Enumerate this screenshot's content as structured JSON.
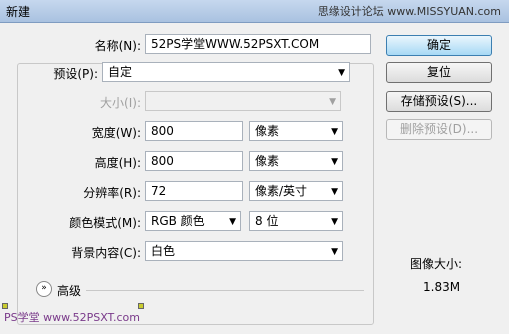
{
  "window": {
    "title": "新建",
    "watermark_top": "思缘设计论坛 www.MISSYUAN.com",
    "watermark_bottom": "PS学堂 www.52PSXT.com"
  },
  "form": {
    "name_label": "名称(N):",
    "name_value": "52PS学堂WWW.52PSXT.COM",
    "preset_label": "预设(P):",
    "preset_value": "自定",
    "size_label": "大小(I):",
    "size_value": "",
    "width_label": "宽度(W):",
    "width_value": "800",
    "width_unit": "像素",
    "height_label": "高度(H):",
    "height_value": "800",
    "height_unit": "像素",
    "resolution_label": "分辨率(R):",
    "resolution_value": "72",
    "resolution_unit": "像素/英寸",
    "color_mode_label": "颜色模式(M):",
    "color_mode_value": "RGB 颜色",
    "bit_depth_value": "8 位",
    "background_label": "背景内容(C):",
    "background_value": "白色",
    "advanced_label": "高级"
  },
  "buttons": {
    "ok": "确定",
    "reset": "复位",
    "save_preset": "存储预设(S)...",
    "delete_preset": "删除预设(D)..."
  },
  "info": {
    "image_size_label": "图像大小:",
    "image_size_value": "1.83M"
  },
  "icons": {
    "dropdown": "chevron-down-icon",
    "expand": "double-chevron-down-icon"
  }
}
